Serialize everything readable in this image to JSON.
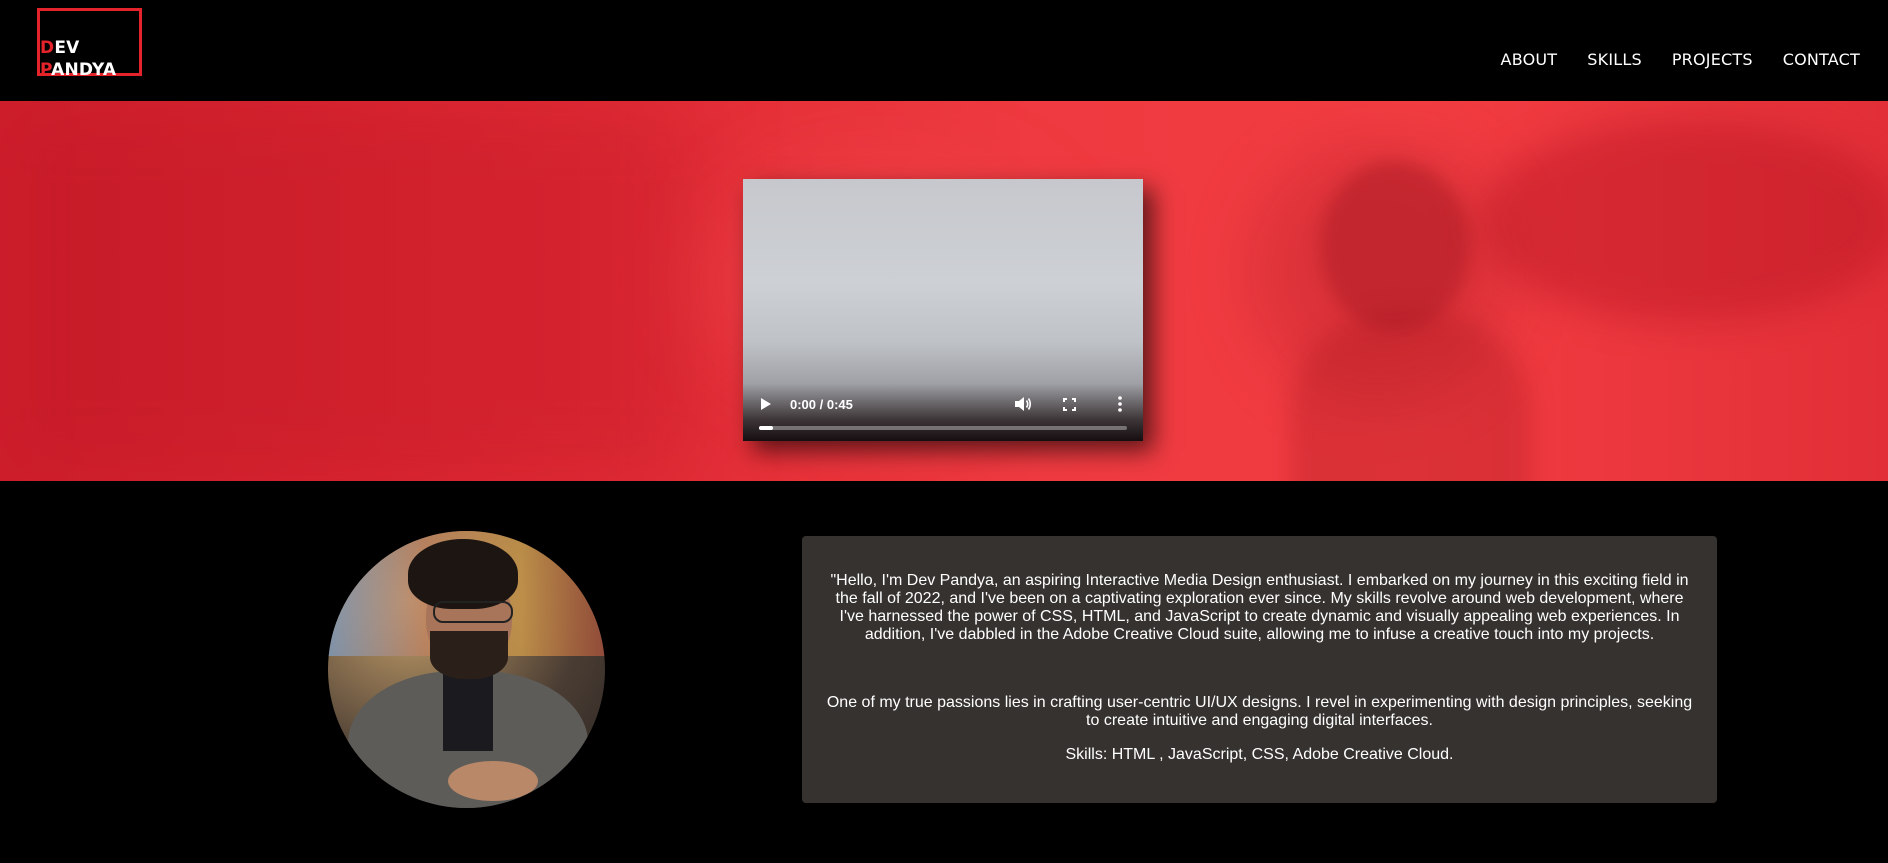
{
  "logo": {
    "first_initial": "D",
    "first_rest": "EV",
    "last_initial": "P",
    "last_rest": "ANDYA"
  },
  "nav": [
    {
      "label": "ABOUT"
    },
    {
      "label": "SKILLS"
    },
    {
      "label": "PROJECTS"
    },
    {
      "label": "CONTACT"
    }
  ],
  "video": {
    "time": "0:00 / 0:45",
    "progress": 0.0,
    "icons": [
      "play-icon",
      "volume-icon",
      "fullscreen-icon",
      "more-options-icon"
    ]
  },
  "about": {
    "paragraph1": "\"Hello, I'm Dev Pandya, an aspiring Interactive Media Design enthusiast. I embarked on my journey in this exciting field in the fall of 2022, and I've been on a captivating exploration ever since. My skills revolve around web development, where I've harnessed the power of CSS, HTML, and JavaScript to create dynamic and visually appealing web experiences. In addition, I've dabbled in the Adobe Creative Cloud suite, allowing me to infuse a creative touch into my projects.",
    "paragraph2": "One of my true passions lies in crafting user-centric UI/UX designs. I revel in experimenting with design principles, seeking to create intuitive and engaging digital interfaces.",
    "skills": "Skills: HTML , JavaScript, CSS, Adobe Creative Cloud."
  },
  "colors": {
    "accent": "#e4232b",
    "hero_red": "#e8333b",
    "panel": "#353230",
    "background": "#000000"
  }
}
